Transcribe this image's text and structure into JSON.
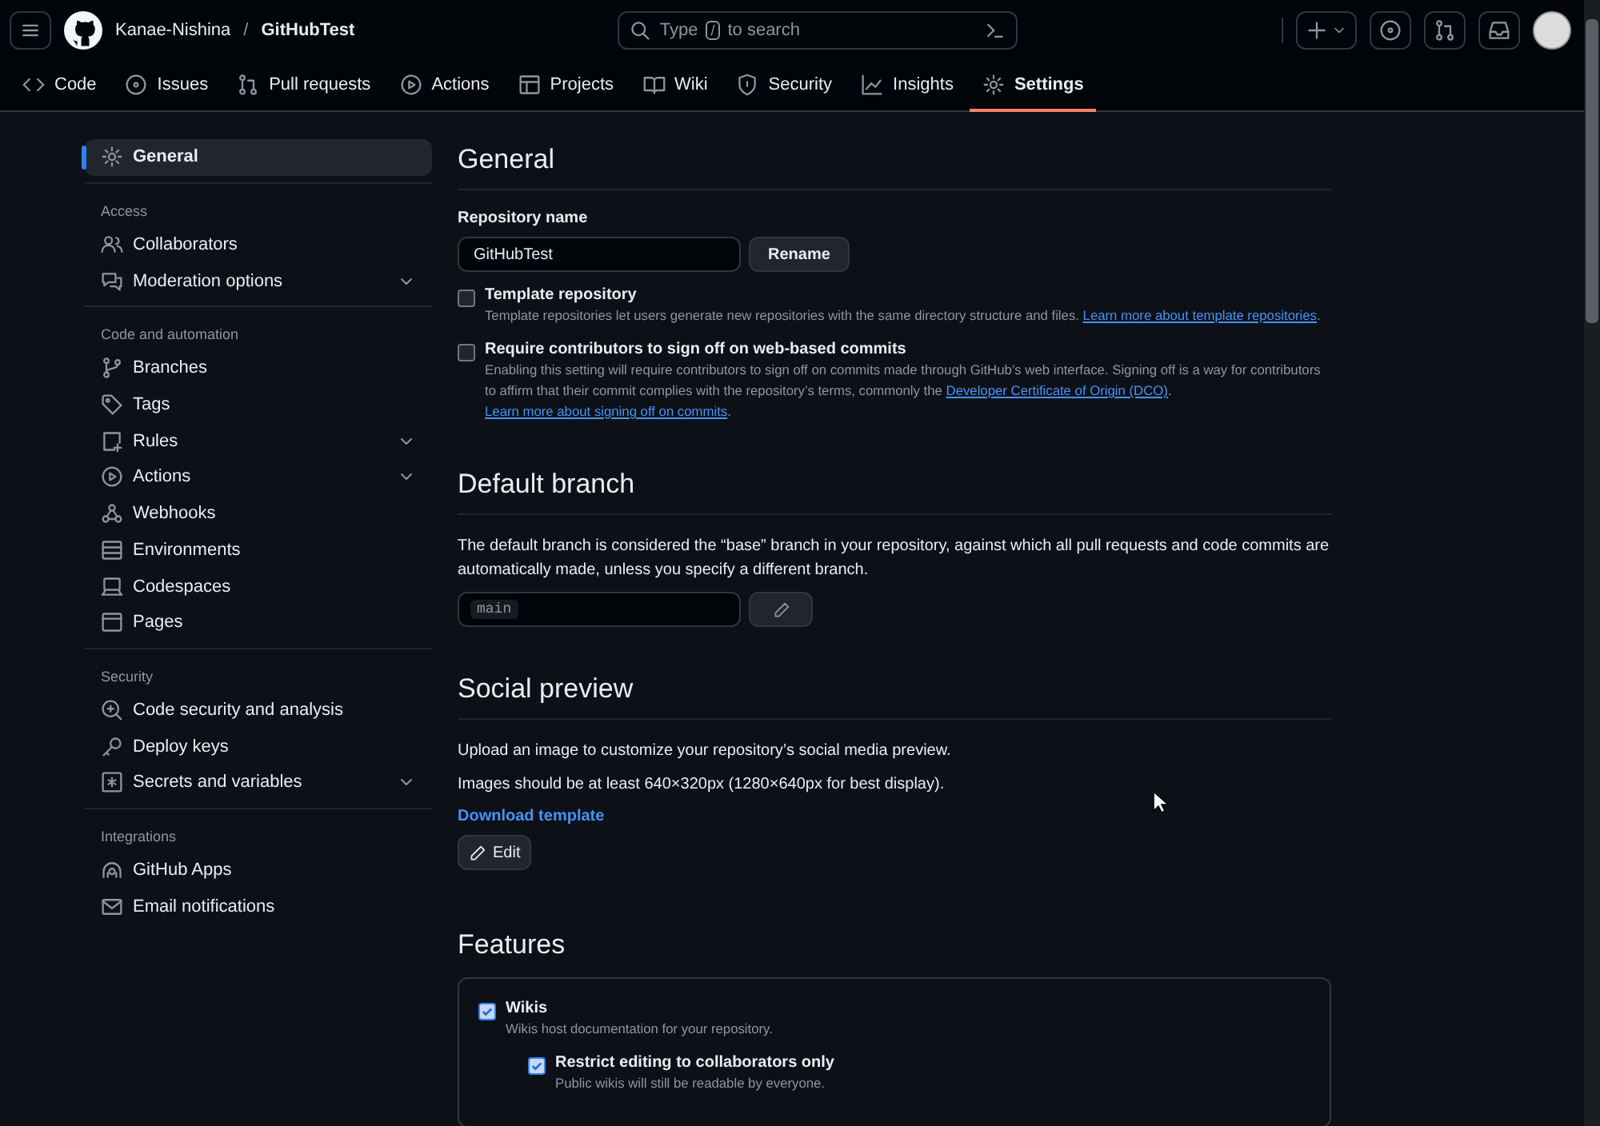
{
  "header": {
    "owner": "Kanae-Nishina",
    "separator": "/",
    "repo": "GitHubTest",
    "search": {
      "before": "Type",
      "key": "/",
      "after": "to search"
    }
  },
  "tabs": [
    {
      "label": "Code",
      "selected": false
    },
    {
      "label": "Issues",
      "selected": false
    },
    {
      "label": "Pull requests",
      "selected": false
    },
    {
      "label": "Actions",
      "selected": false
    },
    {
      "label": "Projects",
      "selected": false
    },
    {
      "label": "Wiki",
      "selected": false
    },
    {
      "label": "Security",
      "selected": false
    },
    {
      "label": "Insights",
      "selected": false
    },
    {
      "label": "Settings",
      "selected": true
    }
  ],
  "sidebar": {
    "groups": [
      {
        "items": [
          {
            "label": "General",
            "selected": true,
            "collapsible": false
          }
        ]
      },
      {
        "heading": "Access",
        "items": [
          {
            "label": "Collaborators",
            "selected": false,
            "collapsible": false
          },
          {
            "label": "Moderation options",
            "selected": false,
            "collapsible": true
          }
        ]
      },
      {
        "heading": "Code and automation",
        "items": [
          {
            "label": "Branches",
            "selected": false,
            "collapsible": false
          },
          {
            "label": "Tags",
            "selected": false,
            "collapsible": false
          },
          {
            "label": "Rules",
            "selected": false,
            "collapsible": true
          },
          {
            "label": "Actions",
            "selected": false,
            "collapsible": true
          },
          {
            "label": "Webhooks",
            "selected": false,
            "collapsible": false
          },
          {
            "label": "Environments",
            "selected": false,
            "collapsible": false
          },
          {
            "label": "Codespaces",
            "selected": false,
            "collapsible": false
          },
          {
            "label": "Pages",
            "selected": false,
            "collapsible": false
          }
        ]
      },
      {
        "heading": "Security",
        "items": [
          {
            "label": "Code security and analysis",
            "selected": false,
            "collapsible": false
          },
          {
            "label": "Deploy keys",
            "selected": false,
            "collapsible": false
          },
          {
            "label": "Secrets and variables",
            "selected": false,
            "collapsible": true
          }
        ]
      },
      {
        "heading": "Integrations",
        "items": [
          {
            "label": "GitHub Apps",
            "selected": false,
            "collapsible": false
          },
          {
            "label": "Email notifications",
            "selected": false,
            "collapsible": false
          }
        ]
      }
    ]
  },
  "general": {
    "title": "General",
    "repo_name_label": "Repository name",
    "repo_name_value": "GitHubTest",
    "rename_button": "Rename",
    "options": [
      {
        "label": "Template repository",
        "checked": false,
        "description": [
          {
            "text": "Template repositories let users generate new repositories with the same directory structure and files. "
          },
          {
            "link": "Learn more about template repositories"
          },
          {
            "text": "."
          }
        ]
      },
      {
        "label": "Require contributors to sign off on web-based commits",
        "checked": false,
        "description": [
          {
            "text": "Enabling this setting will require contributors to sign off on commits made through GitHub’s web interface. Signing off is a way for contributors to affirm that their commit complies with the repository’s terms, commonly the "
          },
          {
            "link": "Developer Certificate of Origin (DCO)"
          },
          {
            "text": ". "
          },
          {
            "link": "Learn more about signing off on commits"
          },
          {
            "text": "."
          }
        ]
      }
    ]
  },
  "default_branch": {
    "title": "Default branch",
    "description": "The default branch is considered the “base” branch in your repository, against which all pull requests and code commits are automatically made, unless you specify a different branch.",
    "branch": "main"
  },
  "social_preview": {
    "title": "Social preview",
    "lines": [
      "Upload an image to customize your repository’s social media preview.",
      "Images should be at least 640×320px (1280×640px for best display)."
    ],
    "download_link": "Download template",
    "edit_button": "Edit"
  },
  "features": {
    "title": "Features",
    "items": [
      {
        "label": "Wikis",
        "checked": true,
        "description": "Wikis host documentation for your repository.",
        "children": [
          {
            "label": "Restrict editing to collaborators only",
            "checked": true,
            "description": "Public wikis will still be readable by everyone."
          }
        ]
      }
    ]
  }
}
